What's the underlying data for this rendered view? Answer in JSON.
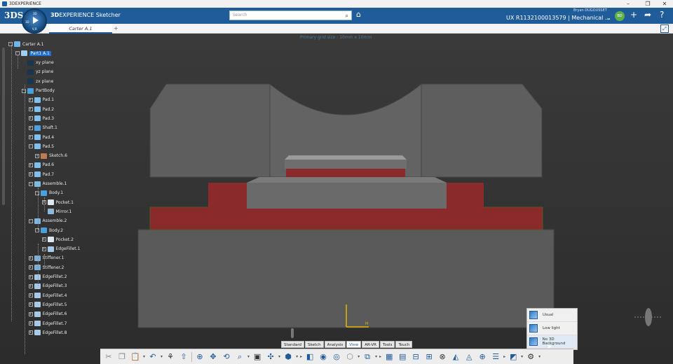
{
  "titlebar": {
    "title": "3DEXPERIENCE",
    "min": "–",
    "max": "❐",
    "close": "✕"
  },
  "topbar": {
    "logo": "3DS",
    "compass": {
      "top": "3D",
      "left": "3D",
      "bottom": "V,R"
    },
    "app_prefix": "3D",
    "app_name": "EXPERIENCE Sketcher",
    "search_placeholder": "Search",
    "user": "Bryan DUGOUSSET",
    "context": "UX R1132100013579 | Mechanical ...",
    "avatar": "BD"
  },
  "tabs": {
    "active": "Carter A.1",
    "add": "+"
  },
  "viewport": {
    "grid_info": "Primary grid size : 10mm x 10mm",
    "axis_h": "H",
    "axis_v": "V"
  },
  "tree": [
    {
      "label": "Carter A.1",
      "depth": 0,
      "icon": "product",
      "exp": "−"
    },
    {
      "label": "Part1 A.1",
      "depth": 1,
      "icon": "part",
      "exp": "−",
      "selected": true
    },
    {
      "label": "xy plane",
      "depth": 2,
      "icon": "plane"
    },
    {
      "label": "yz plane",
      "depth": 2,
      "icon": "plane"
    },
    {
      "label": "zx plane",
      "depth": 2,
      "icon": "plane"
    },
    {
      "label": "PartBody",
      "depth": 2,
      "icon": "body",
      "exp": "−"
    },
    {
      "label": "Pad.1",
      "depth": 3,
      "icon": "pad",
      "exp": "+"
    },
    {
      "label": "Pad.2",
      "depth": 3,
      "icon": "pad",
      "exp": "+"
    },
    {
      "label": "Pad.3",
      "depth": 3,
      "icon": "pad",
      "exp": "+"
    },
    {
      "label": "Shaft.1",
      "depth": 3,
      "icon": "shaft",
      "exp": "+"
    },
    {
      "label": "Pad.4",
      "depth": 3,
      "icon": "pad",
      "exp": "+"
    },
    {
      "label": "Pad.5",
      "depth": 3,
      "icon": "pad",
      "exp": "−"
    },
    {
      "label": "Sketch.6",
      "depth": 4,
      "icon": "sketch",
      "exp": "+"
    },
    {
      "label": "Pad.6",
      "depth": 3,
      "icon": "pad",
      "exp": "+"
    },
    {
      "label": "Pad.7",
      "depth": 3,
      "icon": "pad",
      "exp": "+"
    },
    {
      "label": "Assemble.1",
      "depth": 3,
      "icon": "assemble",
      "exp": "−"
    },
    {
      "label": "Body.1",
      "depth": 4,
      "icon": "body",
      "exp": "−"
    },
    {
      "label": "Pocket.1",
      "depth": 5,
      "icon": "pocket",
      "exp": "+"
    },
    {
      "label": "Mirror.1",
      "depth": 5,
      "icon": "mirror"
    },
    {
      "label": "Assemble.2",
      "depth": 3,
      "icon": "assemble",
      "exp": "−"
    },
    {
      "label": "Body.2",
      "depth": 4,
      "icon": "body",
      "exp": "−"
    },
    {
      "label": "Pocket.2",
      "depth": 5,
      "icon": "pocket",
      "exp": "+"
    },
    {
      "label": "EdgeFillet.1",
      "depth": 5,
      "icon": "fillet",
      "exp": "+"
    },
    {
      "label": "Stiffener.1",
      "depth": 3,
      "icon": "stiffener",
      "exp": "+"
    },
    {
      "label": "Stiffener.2",
      "depth": 3,
      "icon": "stiffener",
      "exp": "+"
    },
    {
      "label": "EdgeFillet.2",
      "depth": 3,
      "icon": "fillet",
      "exp": "+"
    },
    {
      "label": "EdgeFillet.3",
      "depth": 3,
      "icon": "fillet",
      "exp": "+"
    },
    {
      "label": "EdgeFillet.4",
      "depth": 3,
      "icon": "fillet",
      "exp": "+"
    },
    {
      "label": "EdgeFillet.5",
      "depth": 3,
      "icon": "fillet",
      "exp": "+"
    },
    {
      "label": "EdgeFillet.6",
      "depth": 3,
      "icon": "fillet",
      "exp": "+"
    },
    {
      "label": "EdgeFillet.7",
      "depth": 3,
      "icon": "fillet",
      "exp": "+"
    },
    {
      "label": "EdgeFillet.8",
      "depth": 3,
      "icon": "fillet",
      "exp": "+"
    }
  ],
  "action_tabs": [
    "Standard",
    "Sketch",
    "Analysis",
    "View",
    "AR-VR",
    "Tools",
    "Touch"
  ],
  "active_action_tab": "View",
  "background_menu": [
    {
      "label": "Usual",
      "icon": "usual-background-icon"
    },
    {
      "label": "Low light",
      "icon": "low-light-background-icon"
    },
    {
      "label": "No 3D Background",
      "icon": "no-3d-background-icon",
      "active": true
    }
  ],
  "colors": {
    "brand": "#1f5c99",
    "model_gray": "#5d5d5d",
    "model_red": "#8a2a2a",
    "selection": "#1e6fd0"
  }
}
